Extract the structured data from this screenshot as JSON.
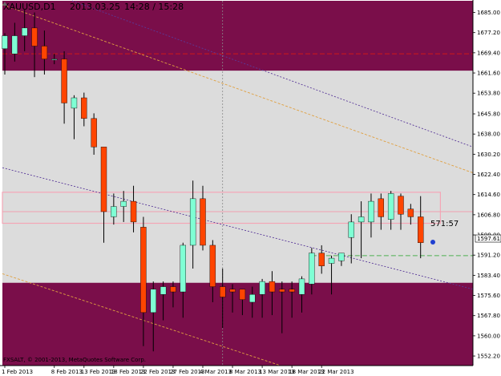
{
  "chart_data": {
    "type": "candlestick",
    "title": "XAUUSD,D1  2013.03.25  14:28 / 15:28",
    "title_parts": {
      "symbol": "XAUUSD,D1",
      "date": "2013.03.25",
      "time": "14:28 / 15:28"
    },
    "copyright": "FXSALT, © 2001-2013, MetaQuotes Software Corp.",
    "timer": "571:57",
    "current_price_label": "1597.61",
    "current_price": 1597.61,
    "ylim": [
      1548.5,
      1689.5
    ],
    "y_ticks": [
      "1685.00",
      "1677.20",
      "1669.40",
      "1661.60",
      "1653.80",
      "1645.80",
      "1638.00",
      "1630.20",
      "1622.40",
      "1614.60",
      "1606.80",
      "1599.00",
      "1591.20",
      "1583.40",
      "1575.60",
      "1567.80",
      "1560.00",
      "1552.20"
    ],
    "x_labels": [
      "1 Feb 2013",
      "8 Feb 2013",
      "13 Feb 2013",
      "18 Feb 2013",
      "22 Feb 2013",
      "27 Feb 2013",
      "4 Mar 2013",
      "8 Mar 2013",
      "13 Mar 2013",
      "18 Mar 2013",
      "22 Mar 2013"
    ],
    "x_label_bars": [
      0,
      5,
      8,
      11,
      14,
      17,
      20,
      23,
      26,
      29,
      32
    ],
    "candles": [
      {
        "o": 1671.0,
        "h": 1677.0,
        "l": 1661.0,
        "c": 1676.0
      },
      {
        "o": 1669.0,
        "h": 1681.0,
        "l": 1666.0,
        "c": 1676.0
      },
      {
        "o": 1676.0,
        "h": 1686.0,
        "l": 1670.0,
        "c": 1679.0
      },
      {
        "o": 1679.0,
        "h": 1685.0,
        "l": 1660.0,
        "c": 1672.0
      },
      {
        "o": 1672.0,
        "h": 1678.0,
        "l": 1661.0,
        "c": 1667.0
      },
      {
        "o": 1667.0,
        "h": 1669.0,
        "l": 1665.0,
        "c": 1667.0
      },
      {
        "o": 1667.0,
        "h": 1670.0,
        "l": 1642.0,
        "c": 1650.0
      },
      {
        "o": 1648.0,
        "h": 1653.0,
        "l": 1636.0,
        "c": 1652.0
      },
      {
        "o": 1652.0,
        "h": 1654.0,
        "l": 1641.0,
        "c": 1644.0
      },
      {
        "o": 1644.0,
        "h": 1646.0,
        "l": 1630.0,
        "c": 1633.0
      },
      {
        "o": 1633.0,
        "h": 1633.0,
        "l": 1596.0,
        "c": 1608.0
      },
      {
        "o": 1606.0,
        "h": 1615.0,
        "l": 1603.0,
        "c": 1610.0
      },
      {
        "o": 1610.0,
        "h": 1616.0,
        "l": 1604.0,
        "c": 1612.0
      },
      {
        "o": 1612.0,
        "h": 1618.0,
        "l": 1600.0,
        "c": 1604.0
      },
      {
        "o": 1602.0,
        "h": 1606.0,
        "l": 1556.0,
        "c": 1569.0
      },
      {
        "o": 1569.0,
        "h": 1581.0,
        "l": 1554.0,
        "c": 1578.0
      },
      {
        "o": 1576.0,
        "h": 1581.0,
        "l": 1566.0,
        "c": 1579.0
      },
      {
        "o": 1579.0,
        "h": 1581.0,
        "l": 1571.0,
        "c": 1577.0
      },
      {
        "o": 1577.0,
        "h": 1596.0,
        "l": 1567.0,
        "c": 1595.0
      },
      {
        "o": 1595.0,
        "h": 1620.0,
        "l": 1586.0,
        "c": 1613.0
      },
      {
        "o": 1613.0,
        "h": 1618.0,
        "l": 1593.0,
        "c": 1595.0
      },
      {
        "o": 1595.0,
        "h": 1597.0,
        "l": 1573.0,
        "c": 1579.0
      },
      {
        "o": 1579.0,
        "h": 1586.0,
        "l": 1563.0,
        "c": 1575.0
      },
      {
        "o": 1578.0,
        "h": 1580.0,
        "l": 1569.0,
        "c": 1577.0
      },
      {
        "o": 1578.0,
        "h": 1578.0,
        "l": 1568.0,
        "c": 1574.0
      },
      {
        "o": 1573.0,
        "h": 1579.0,
        "l": 1567.0,
        "c": 1576.0
      },
      {
        "o": 1576.0,
        "h": 1582.0,
        "l": 1567.0,
        "c": 1581.0
      },
      {
        "o": 1581.0,
        "h": 1585.0,
        "l": 1568.0,
        "c": 1577.0
      },
      {
        "o": 1578.0,
        "h": 1581.0,
        "l": 1561.0,
        "c": 1577.0
      },
      {
        "o": 1578.0,
        "h": 1581.0,
        "l": 1567.0,
        "c": 1577.0
      },
      {
        "o": 1576.0,
        "h": 1583.0,
        "l": 1569.0,
        "c": 1582.0
      },
      {
        "o": 1580.0,
        "h": 1594.0,
        "l": 1576.0,
        "c": 1592.0
      },
      {
        "o": 1592.0,
        "h": 1595.0,
        "l": 1584.0,
        "c": 1587.0
      },
      {
        "o": 1588.0,
        "h": 1591.0,
        "l": 1576.0,
        "c": 1590.0
      },
      {
        "o": 1589.0,
        "h": 1592.0,
        "l": 1587.0,
        "c": 1592.0
      },
      {
        "o": 1598.0,
        "h": 1607.0,
        "l": 1588.0,
        "c": 1604.0
      },
      {
        "o": 1604.0,
        "h": 1612.0,
        "l": 1590.0,
        "c": 1606.0
      },
      {
        "o": 1604.0,
        "h": 1615.0,
        "l": 1598.0,
        "c": 1612.0
      },
      {
        "o": 1613.0,
        "h": 1615.0,
        "l": 1601.0,
        "c": 1606.0
      },
      {
        "o": 1605.0,
        "h": 1616.0,
        "l": 1601.0,
        "c": 1615.0
      },
      {
        "o": 1614.0,
        "h": 1615.0,
        "l": 1601.0,
        "c": 1607.0
      },
      {
        "o": 1609.0,
        "h": 1611.0,
        "l": 1603.0,
        "c": 1606.0
      },
      {
        "o": 1606.0,
        "h": 1614.0,
        "l": 1590.0,
        "c": 1596.0
      }
    ],
    "zones": [
      {
        "from": 1662.5,
        "to": 1689.5,
        "color": "#7a0e4a"
      },
      {
        "from": 1548.5,
        "to": 1580.5,
        "color": "#7a0e4a"
      }
    ],
    "middle_band_color": "#dcdcdc",
    "pink_rectangle": {
      "from": 1603.5,
      "to": 1615.5,
      "start_bar": 0,
      "end_bar": 44
    },
    "horizontal_lines": [
      {
        "price": 1608.0,
        "color": "#f0a0b0",
        "style": "solid"
      },
      {
        "price": 1669.0,
        "color": "#d01818",
        "style": "dash"
      },
      {
        "price": 1591.0,
        "color": "#4caf50",
        "style": "dash",
        "start_bar": 31
      }
    ],
    "colors": {
      "bull": "#7fffd4",
      "bear": "#ff4500",
      "wick": "#000000",
      "zone": "#7a0e4a",
      "axis_bg": "#ffffff",
      "trend_purple": "#5a3a9a",
      "trend_orange": "#e0a040"
    },
    "grid": false
  }
}
